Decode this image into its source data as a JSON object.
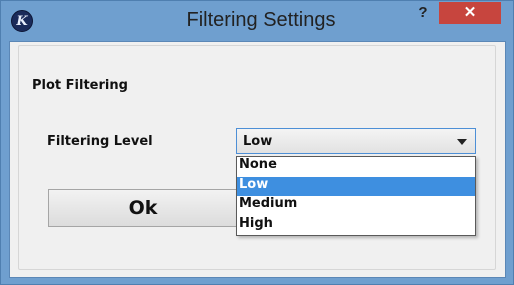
{
  "window": {
    "app_icon_glyph": "K",
    "title": "Filtering Settings",
    "help_label": "?",
    "close_label": "✕"
  },
  "group": {
    "title": "Plot Filtering"
  },
  "filtering_level": {
    "label": "Filtering Level",
    "selected": "Low",
    "options": [
      "None",
      "Low",
      "Medium",
      "High"
    ],
    "highlighted_index": 1
  },
  "buttons": {
    "ok_label": "Ok"
  },
  "colors": {
    "titlebar": "#6f9fcf",
    "close_button": "#c7453e",
    "selection": "#3e8fe0",
    "focus_border": "#4d8fd6"
  }
}
